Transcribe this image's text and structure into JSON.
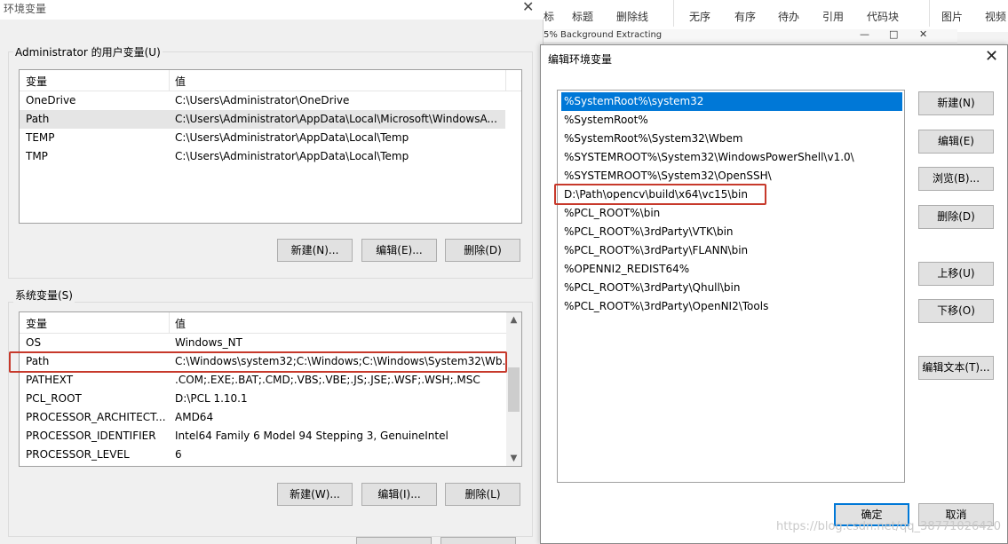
{
  "env_dialog": {
    "title": "环境变量",
    "close_glyph": "✕",
    "user_group_label": "Administrator 的用户变量(U)",
    "system_group_label": "系统变量(S)",
    "columns": {
      "name": "变量",
      "value": "值"
    },
    "user_vars": [
      {
        "name": "OneDrive",
        "value": "C:\\Users\\Administrator\\OneDrive"
      },
      {
        "name": "Path",
        "value": "C:\\Users\\Administrator\\AppData\\Local\\Microsoft\\WindowsA..."
      },
      {
        "name": "TEMP",
        "value": "C:\\Users\\Administrator\\AppData\\Local\\Temp"
      },
      {
        "name": "TMP",
        "value": "C:\\Users\\Administrator\\AppData\\Local\\Temp"
      }
    ],
    "system_vars": [
      {
        "name": "OS",
        "value": "Windows_NT"
      },
      {
        "name": "Path",
        "value": "C:\\Windows\\system32;C:\\Windows;C:\\Windows\\System32\\Wb..."
      },
      {
        "name": "PATHEXT",
        "value": ".COM;.EXE;.BAT;.CMD;.VBS;.VBE;.JS;.JSE;.WSF;.WSH;.MSC"
      },
      {
        "name": "PCL_ROOT",
        "value": "D:\\PCL 1.10.1"
      },
      {
        "name": "PROCESSOR_ARCHITECT...",
        "value": "AMD64"
      },
      {
        "name": "PROCESSOR_IDENTIFIER",
        "value": "Intel64 Family 6 Model 94 Stepping 3, GenuineIntel"
      },
      {
        "name": "PROCESSOR_LEVEL",
        "value": "6"
      }
    ],
    "user_buttons": {
      "new": "新建(N)...",
      "edit": "编辑(E)...",
      "delete": "删除(D)"
    },
    "system_buttons": {
      "new": "新建(W)...",
      "edit": "编辑(I)...",
      "delete": "删除(L)"
    }
  },
  "background_toolbar": {
    "items": [
      "标",
      "标题",
      "删除线",
      "无序",
      "有序",
      "待办",
      "引用",
      "代码块",
      "图片",
      "视频"
    ],
    "strip_text": "5% Background Extracting",
    "strip_controls": [
      "—",
      "□",
      "✕"
    ]
  },
  "edit_dialog": {
    "title": "编辑环境变量",
    "close_glyph": "✕",
    "paths": [
      "%SystemRoot%\\system32",
      "%SystemRoot%",
      "%SystemRoot%\\System32\\Wbem",
      "%SYSTEMROOT%\\System32\\WindowsPowerShell\\v1.0\\",
      "%SYSTEMROOT%\\System32\\OpenSSH\\",
      "D:\\Path\\opencv\\build\\x64\\vc15\\bin",
      "%PCL_ROOT%\\bin",
      "%PCL_ROOT%\\3rdParty\\VTK\\bin",
      "%PCL_ROOT%\\3rdParty\\FLANN\\bin",
      "%OPENNI2_REDIST64%",
      "%PCL_ROOT%\\3rdParty\\Qhull\\bin",
      "%PCL_ROOT%\\3rdParty\\OpenNI2\\Tools"
    ],
    "buttons": {
      "new": "新建(N)",
      "edit": "编辑(E)",
      "browse": "浏览(B)...",
      "delete": "删除(D)",
      "move_up": "上移(U)",
      "move_down": "下移(O)",
      "edit_text": "编辑文本(T)...",
      "ok": "确定",
      "cancel": "取消"
    }
  },
  "watermark": "https://blog.csdn.net/qq_38771026420"
}
